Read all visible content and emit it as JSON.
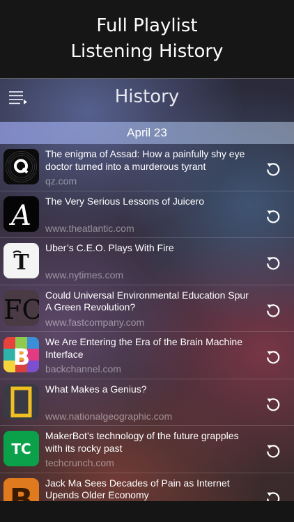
{
  "promo": {
    "line1": "Full Playlist",
    "line2": "Listening History"
  },
  "navbar": {
    "title": "History",
    "menu_icon": "playlist-menu-icon"
  },
  "date_header": "April 23",
  "items": [
    {
      "title": "The enigma of Assad: How a painfully shy eye doctor turned into a murderous tyrant",
      "source": "qz.com",
      "icon": "qz-logo"
    },
    {
      "title": "The Very Serious Lessons of Juicero",
      "source": "www.theatlantic.com",
      "icon": "the-atlantic-logo"
    },
    {
      "title": "Uber’s C.E.O. Plays With Fire",
      "source": "www.nytimes.com",
      "icon": "nytimes-logo"
    },
    {
      "title": "Could Universal Environmental Education Spur A Green Revolution?",
      "source": "www.fastcompany.com",
      "icon": "fast-company-logo"
    },
    {
      "title": "We Are Entering the Era of the Brain Machine Interface",
      "source": "backchannel.com",
      "icon": "backchannel-logo"
    },
    {
      "title": "What Makes a Genius?",
      "source": "www.nationalgeographic.com",
      "icon": "national-geographic-logo"
    },
    {
      "title": "MakerBot’s technology of the future grapples with its rocky past",
      "source": "techcrunch.com",
      "icon": "techcrunch-logo"
    },
    {
      "title": "Jack Ma Sees Decades of Pain as Internet Upends Older Economy",
      "source": "",
      "icon": "bloomberg-logo"
    }
  ],
  "replay_icon": "replay-icon"
}
